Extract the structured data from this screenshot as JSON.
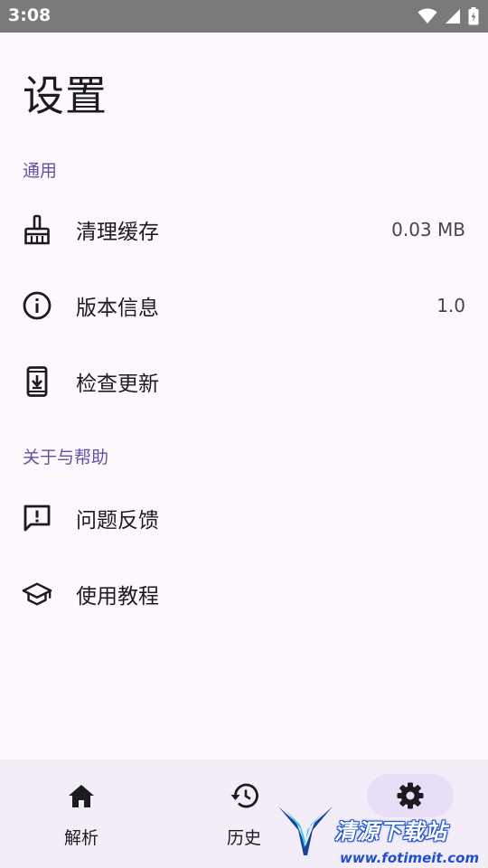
{
  "status_bar": {
    "time": "3:08"
  },
  "page": {
    "title": "设置"
  },
  "sections": {
    "general": {
      "header": "通用",
      "items": [
        {
          "label": "清理缓存",
          "value": "0.03 MB",
          "icon": "broom-icon"
        },
        {
          "label": "版本信息",
          "value": "1.0",
          "icon": "info-icon"
        },
        {
          "label": "检查更新",
          "value": "",
          "icon": "phone-download-icon"
        }
      ]
    },
    "about": {
      "header": "关于与帮助",
      "items": [
        {
          "label": "问题反馈",
          "icon": "feedback-icon"
        },
        {
          "label": "使用教程",
          "icon": "school-icon"
        }
      ]
    }
  },
  "bottom_nav": {
    "items": [
      {
        "label": "解析",
        "icon": "home-icon"
      },
      {
        "label": "历史",
        "icon": "history-icon"
      },
      {
        "label": "",
        "icon": "gear-icon",
        "active": true
      }
    ]
  },
  "watermark": {
    "title": "清源下载站",
    "url": "www.fotimeit.com"
  },
  "colors": {
    "accent": "#6750a4",
    "background": "#fdf7fe",
    "nav_background": "#f3edf7",
    "active_pill": "#e8def8"
  }
}
